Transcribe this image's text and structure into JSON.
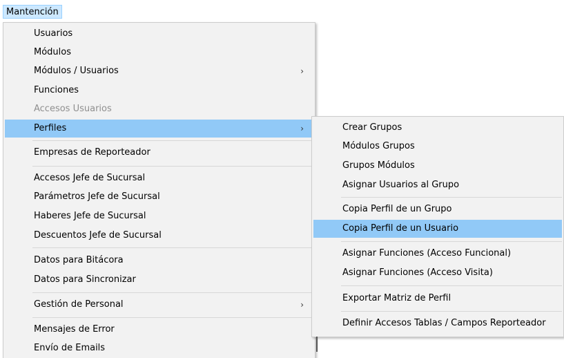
{
  "menubar": {
    "mantencion_label": "Mantención"
  },
  "main_menu": {
    "usuarios": "Usuarios",
    "modulos": "Módulos",
    "modulos_usuarios": "Módulos / Usuarios",
    "funciones": "Funciones",
    "accesos_usuarios": "Accesos Usuarios",
    "perfiles": "Perfiles",
    "empresas_reporteador": "Empresas de Reporteador",
    "accesos_jefe": "Accesos Jefe de Sucursal",
    "parametros_jefe": "Parámetros Jefe de Sucursal",
    "haberes_jefe": "Haberes Jefe de Sucursal",
    "descuentos_jefe": "Descuentos Jefe de Sucursal",
    "datos_bitacora": "Datos para Bitácora",
    "datos_sincronizar": "Datos para Sincronizar",
    "gestion_personal": "Gestión de Personal",
    "mensajes_error": "Mensajes de Error",
    "envio_emails": "Envío de Emails",
    "submenu_arrow": "›"
  },
  "perfiles_submenu": {
    "crear_grupos": "Crear Grupos",
    "modulos_grupos": "Módulos Grupos",
    "grupos_modulos": "Grupos Módulos",
    "asignar_usuarios": "Asignar Usuarios al Grupo",
    "copia_grupo": "Copia Perfil de un Grupo",
    "copia_usuario": "Copia Perfil de un Usuario",
    "asignar_funcional": "Asignar Funciones (Acceso Funcional)",
    "asignar_visita": "Asignar Funciones (Acceso Visita)",
    "exportar_matriz": "Exportar Matriz de Perfil",
    "definir_accesos": "Definir Accesos Tablas / Campos Reporteador"
  },
  "colors": {
    "highlight": "#91c9f7",
    "menu_bg": "#f2f2f2",
    "menubar_active": "#cce8ff"
  }
}
